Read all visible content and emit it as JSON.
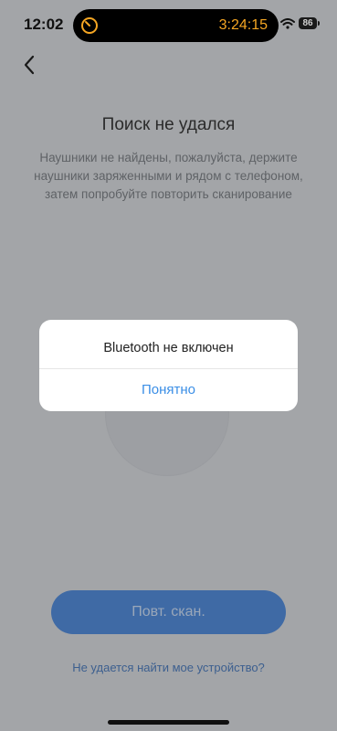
{
  "status_bar": {
    "time": "12:02",
    "timer": "3:24:15",
    "battery": "86",
    "icons": [
      "timer-icon",
      "wifi-icon",
      "battery-icon"
    ]
  },
  "header": {
    "back_icon": "chevron-left-icon"
  },
  "main": {
    "title": "Поиск не удался",
    "description": "Наушники не найдены, пожалуйста, держите наушники заряженными и рядом с телефоном, затем попробуйте повторить сканирование",
    "rescan_label": "Повт. скан.",
    "help_link": "Не удается найти мое устройство?"
  },
  "dialog": {
    "title": "Bluetooth не включен",
    "button_label": "Понятно"
  },
  "colors": {
    "accent": "#3a8ee6",
    "overlay_background": "#a3a5a8",
    "timer": "#f5a623"
  }
}
